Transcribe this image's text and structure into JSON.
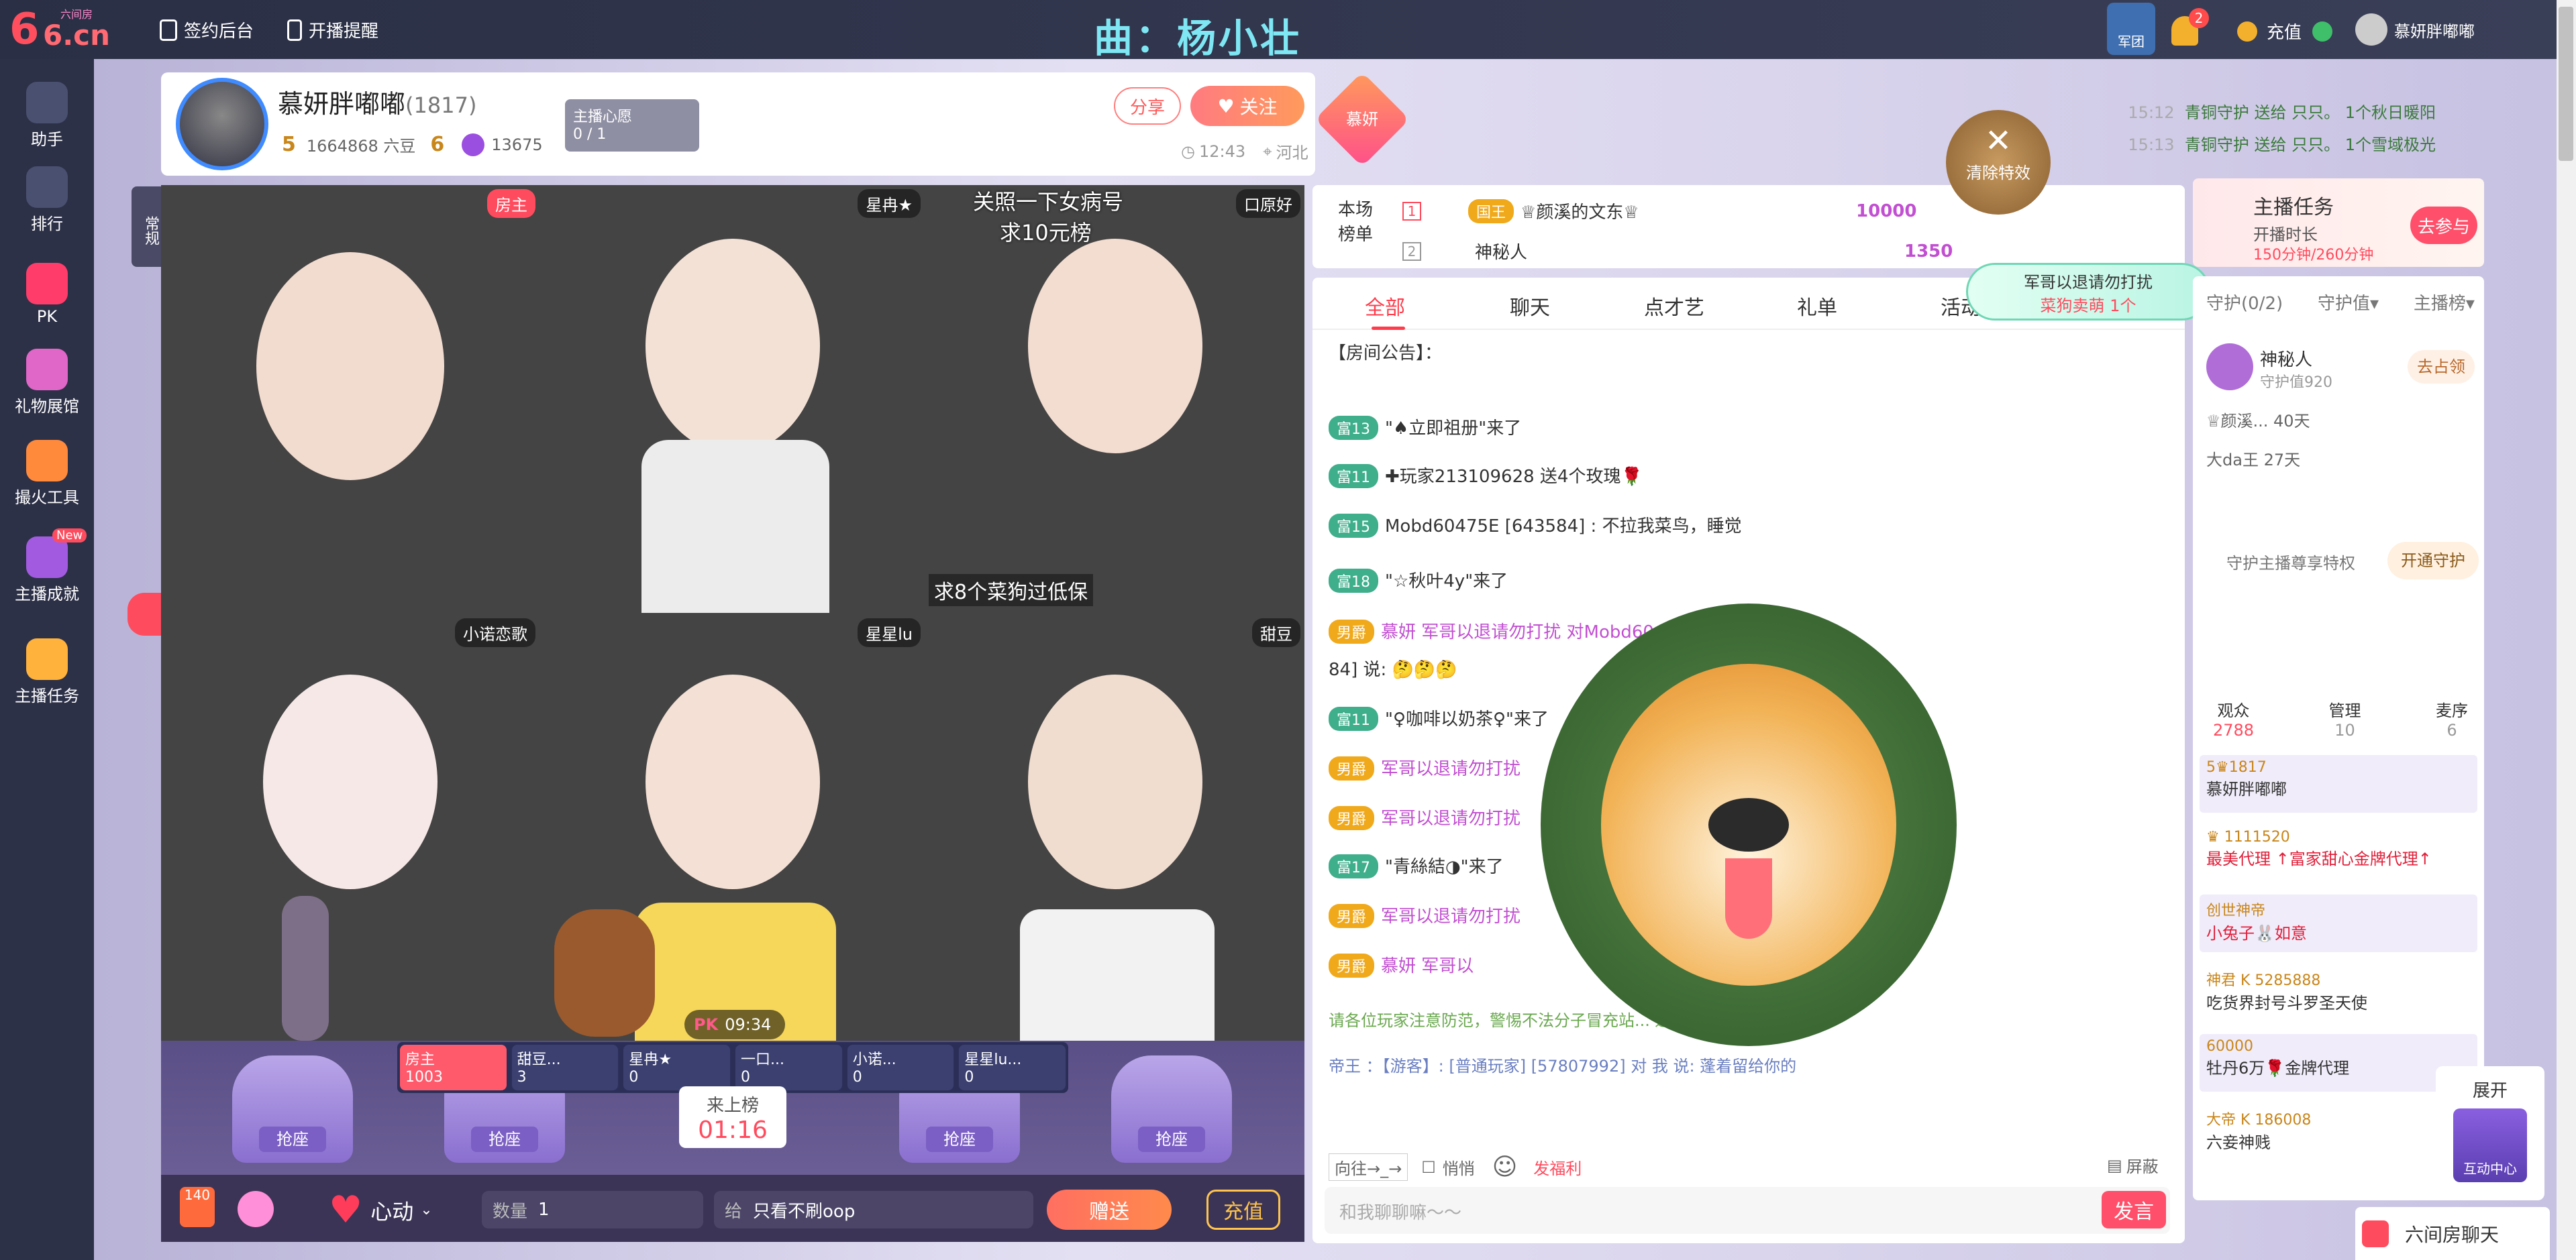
{
  "topbar": {
    "logo_text": "6.cn",
    "logo_sub": "六间房",
    "sign_backend": "签约后台",
    "live_reminder": "开播提醒",
    "song": "曲：杨小壮",
    "army": "军团",
    "notif_count": "2",
    "recharge": "充值",
    "username": "慕妍胖嘟嘟"
  },
  "rail": [
    {
      "label": "助手",
      "icon": "assistant-icon",
      "color": "#4a5070"
    },
    {
      "label": "排行",
      "icon": "crown-icon",
      "color": "#4a5070"
    },
    {
      "label": "PK",
      "icon": "pk-icon",
      "color": "#ff3c6a"
    },
    {
      "label": "礼物展馆",
      "icon": "gift-hall-icon",
      "color": "#e066c8"
    },
    {
      "label": "撮火工具",
      "icon": "tool-icon",
      "color": "#ff8a3c"
    },
    {
      "label": "主播成就",
      "icon": "achievement-icon",
      "color": "#a25be0",
      "badge": "New"
    },
    {
      "label": "主播任务",
      "icon": "task-icon",
      "color": "#ffb23c"
    }
  ],
  "anchor": {
    "name": "慕妍胖嘟嘟",
    "id": "(1817)",
    "level": "5",
    "beans": "1664868 六豆",
    "level2": "6",
    "coins": "13675",
    "wish_title": "主播心愿",
    "wish_progress": "0 / 1",
    "share": "分享",
    "follow": "关注",
    "fan_badge": "慕妍",
    "time": "12:43",
    "location": "河北"
  },
  "gifts_feed": [
    {
      "time": "15:12",
      "text": "青铜守护 送给 只只。 1个秋日暖阳"
    },
    {
      "time": "15:13",
      "text": "青铜守护 送给 只只。 1个雪域极光"
    }
  ],
  "grid": {
    "side_label": "常规",
    "cells": [
      {
        "tag": "房主",
        "tag_color": "#ff4b5e",
        "bg": "#d9c3b8"
      },
      {
        "tag": "星冉★",
        "tag_color": "rgba(0,0,0,.45)",
        "bg": "#6a5850"
      },
      {
        "tag": "口原好",
        "tag_color": "rgba(0,0,0,.45)",
        "bg": "#b8aca0",
        "overlay_top": "关照一下女病号",
        "overlay_top2": "求10元榜",
        "overlay_bottom": "求8个菜狗过低保"
      },
      {
        "tag": "小诺恋歌",
        "tag_color": "rgba(0,0,0,.45)",
        "bg": "#e9e6ef"
      },
      {
        "tag": "星星lu",
        "tag_color": "rgba(0,0,0,.45)",
        "bg": "#cfc8d8"
      },
      {
        "tag": "甜豆",
        "tag_color": "rgba(0,0,0,.45)",
        "bg": "#c4b8a6"
      }
    ]
  },
  "pk": {
    "label": "PK",
    "time": "09:34",
    "players": [
      {
        "name": "房主",
        "score": "1003"
      },
      {
        "name": "甜豆...",
        "score": "3"
      },
      {
        "name": "星冉★",
        "score": "0"
      },
      {
        "name": "一口...",
        "score": "0"
      },
      {
        "name": "小诺...",
        "score": "0"
      },
      {
        "name": "星星lu...",
        "score": "0"
      }
    ],
    "board_label": "来上榜",
    "board_time": "01:16"
  },
  "seats": {
    "grab": "抢座"
  },
  "giftbar": {
    "count": "140",
    "gift_name": "心动",
    "qty_label": "数量",
    "qty_value": "1",
    "to_label": "给",
    "to_value": "只看不刷oop",
    "send": "赠送",
    "recharge": "充值"
  },
  "rank": {
    "title": "本场",
    "title2": "榜单",
    "rows": [
      {
        "no": "1",
        "badge": "国王",
        "name": "♕颜溪的文东♕",
        "value": "10000"
      },
      {
        "no": "2",
        "badge": "",
        "name": "神秘人",
        "value": "1350"
      }
    ]
  },
  "chat": {
    "tabs": [
      "全部",
      "聊天",
      "点才艺",
      "礼单",
      "活动"
    ],
    "notice_label": "【房间公告】：",
    "messages": [
      {
        "badge": "富13",
        "type": "rich",
        "text": "\"♠立即祖册\"来了"
      },
      {
        "badge": "富11",
        "type": "rich",
        "text": "✚玩家213109628 送4个玫瑰🌹"
      },
      {
        "badge": "富15",
        "type": "rich",
        "text": "Mobd60475E [643584] : 不拉我菜鸟，睡觉"
      },
      {
        "badge": "富18",
        "type": "rich",
        "text": "\"☆秋叶4y\"来了"
      },
      {
        "badge": "男爵",
        "type": "noble",
        "text": "慕妍 军哥以退请勿打扰 对Mobd60475E[6435"
      },
      {
        "badge": "",
        "type": "plain",
        "text": "84] 说: 🤔🤔🤔"
      },
      {
        "badge": "富11",
        "type": "rich",
        "text": "\"♀咖啡以奶茶♀\"来了"
      },
      {
        "badge": "男爵",
        "type": "noble",
        "text": "军哥以退请勿打扰"
      },
      {
        "badge": "男爵",
        "type": "noble",
        "text": "军哥以退请勿打扰"
      },
      {
        "badge": "富17",
        "type": "rich",
        "text": "\"青絲結◑\"来了"
      },
      {
        "badge": "男爵",
        "type": "noble",
        "text": "军哥以退请勿打扰"
      },
      {
        "badge": "男爵",
        "type": "noble",
        "text": "慕妍 军哥以"
      }
    ],
    "warning": "请各位玩家注意防范，警惕不法分子冒充站... 避免财产受到损失。",
    "private_line": "帝王 ：【游客】: [普通玩家] [57807992] 对 我 说: 蓬着留给你的",
    "target": "向往→_→",
    "whisper": "悄悄",
    "shield": "屏蔽",
    "redpack": "发福利",
    "placeholder": "和我聊聊嘛～～",
    "send": "发言"
  },
  "effects": {
    "clear": "清除特效",
    "promo_line1": "军哥以退请勿打扰",
    "promo_line2": "菜狗卖萌 1个"
  },
  "right": {
    "task_title": "主播任务",
    "task_sub": "开播时长",
    "task_progress": "150分钟/260分钟",
    "join": "去参与",
    "guard_tabs": [
      "守护(0/2)",
      "守护值▾",
      "主播榜▾"
    ],
    "guards": [
      {
        "name": "神秘人",
        "sub": "守护值920",
        "action": "去占领"
      },
      {
        "name": "♕颜溪... 40天",
        "sub": "",
        "action": ""
      },
      {
        "name": "大da王 27天",
        "sub": "",
        "action": ""
      }
    ],
    "guard_privilege": "守护主播尊享特权",
    "open_guard": "开通守护",
    "aud_tabs": [
      {
        "label": "观众",
        "count": "2788"
      },
      {
        "label": "管理",
        "count": "10"
      },
      {
        "label": "麦序",
        "count": "6"
      }
    ],
    "audience": [
      {
        "line1": "5♛1817",
        "line2": "慕妍胖嘟嘟"
      },
      {
        "line1": "♛ 1111520",
        "line2": "最美代理 ↑富家甜心金牌代理↑"
      },
      {
        "line1": "创世神帝",
        "line2": "小兔子🐰如意"
      },
      {
        "line1": "神君 K 5285888",
        "line2": "吃货界封号斗罗圣天使"
      },
      {
        "line1": "60000",
        "line2": "牡丹6万🌹金牌代理"
      },
      {
        "line1": "大帝 K 186008",
        "line2": "六妾神贱"
      }
    ],
    "expand": "展开",
    "interaction": "互动中心",
    "room_chat": "六间房聊天"
  }
}
